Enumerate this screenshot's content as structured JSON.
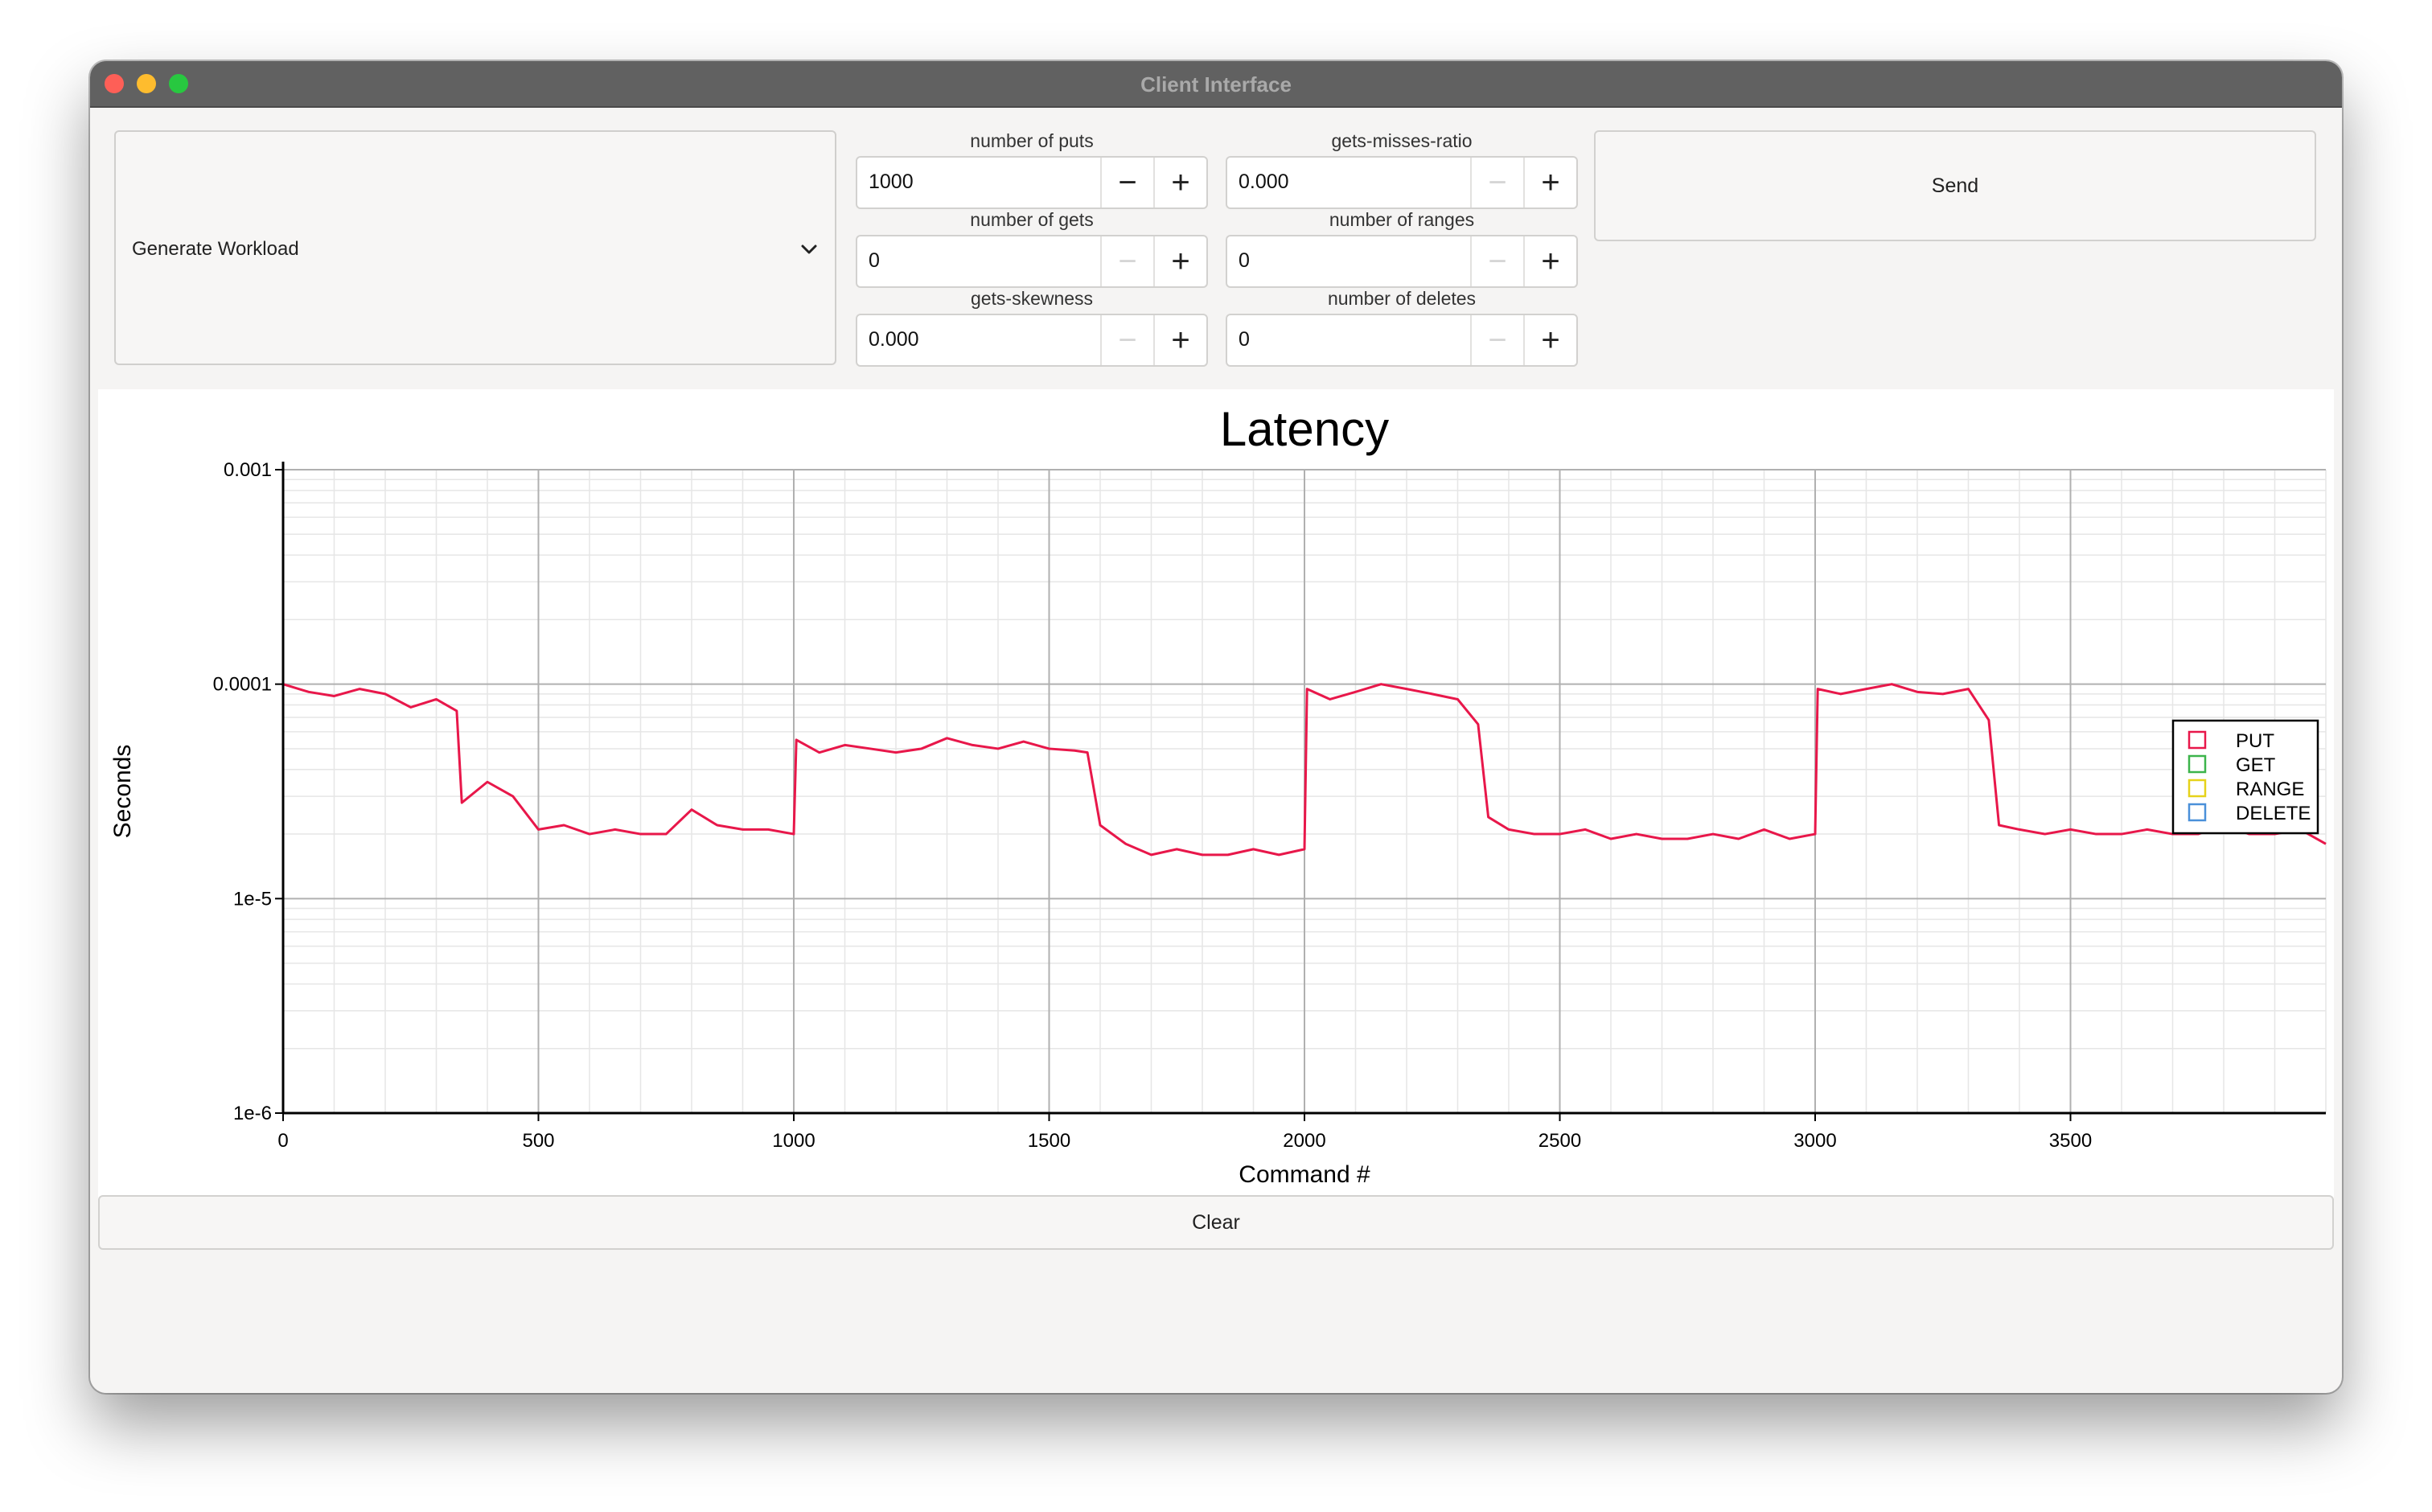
{
  "window": {
    "title": "Client Interface"
  },
  "workload": {
    "selected": "Generate Workload"
  },
  "fields": [
    {
      "label": "number of puts",
      "value": "1000"
    },
    {
      "label": "gets-misses-ratio",
      "value": "0.000"
    },
    {
      "label": "number of gets",
      "value": "0"
    },
    {
      "label": "number of ranges",
      "value": "0"
    },
    {
      "label": "gets-skewness",
      "value": "0.000"
    },
    {
      "label": "number of deletes",
      "value": "0"
    }
  ],
  "buttons": {
    "send": "Send",
    "clear": "Clear",
    "minus": "−",
    "plus": "+"
  },
  "chart_data": {
    "type": "line",
    "title": "Latency",
    "xlabel": "Command #",
    "ylabel": "Seconds",
    "y_scale": "log",
    "xlim": [
      0,
      4000
    ],
    "ylim": [
      1e-06,
      0.001
    ],
    "x_ticks": [
      "0",
      "500",
      "1000",
      "1500",
      "2000",
      "2500",
      "3000",
      "3500"
    ],
    "y_ticks": [
      "1e-6",
      "1e-5",
      "0.0001",
      "0.001"
    ],
    "grid": true,
    "legend_position": "right",
    "legend": [
      {
        "name": "PUT",
        "color": "#e8174a"
      },
      {
        "name": "GET",
        "color": "#3cb44b"
      },
      {
        "name": "RANGE",
        "color": "#e6d21a"
      },
      {
        "name": "DELETE",
        "color": "#4a90d9"
      }
    ],
    "series": [
      {
        "name": "PUT",
        "color": "#e8174a",
        "x": [
          0,
          50,
          100,
          150,
          200,
          250,
          300,
          340,
          350,
          400,
          450,
          500,
          550,
          600,
          650,
          700,
          750,
          800,
          850,
          900,
          950,
          1000,
          1005,
          1050,
          1100,
          1150,
          1200,
          1250,
          1300,
          1350,
          1400,
          1450,
          1500,
          1550,
          1575,
          1600,
          1650,
          1700,
          1750,
          1800,
          1850,
          1900,
          1950,
          2000,
          2005,
          2050,
          2100,
          2150,
          2200,
          2250,
          2300,
          2340,
          2360,
          2400,
          2450,
          2500,
          2550,
          2600,
          2650,
          2700,
          2750,
          2800,
          2850,
          2900,
          2950,
          3000,
          3005,
          3050,
          3100,
          3150,
          3200,
          3250,
          3300,
          3340,
          3360,
          3400,
          3450,
          3500,
          3550,
          3600,
          3650,
          3700,
          3750,
          3800,
          3850,
          3900,
          3950,
          4000
        ],
        "y": [
          0.0001,
          9.2e-05,
          8.8e-05,
          9.5e-05,
          9e-05,
          7.8e-05,
          8.5e-05,
          7.5e-05,
          2.8e-05,
          3.5e-05,
          3e-05,
          2.1e-05,
          2.2e-05,
          2e-05,
          2.1e-05,
          2e-05,
          2e-05,
          2.6e-05,
          2.2e-05,
          2.1e-05,
          2.1e-05,
          2e-05,
          5.5e-05,
          4.8e-05,
          5.2e-05,
          5e-05,
          4.8e-05,
          5e-05,
          5.6e-05,
          5.2e-05,
          5e-05,
          5.4e-05,
          5e-05,
          4.9e-05,
          4.8e-05,
          2.2e-05,
          1.8e-05,
          1.6e-05,
          1.7e-05,
          1.6e-05,
          1.6e-05,
          1.7e-05,
          1.6e-05,
          1.7e-05,
          9.5e-05,
          8.5e-05,
          9.2e-05,
          0.0001,
          9.5e-05,
          9e-05,
          8.5e-05,
          6.5e-05,
          2.4e-05,
          2.1e-05,
          2e-05,
          2e-05,
          2.1e-05,
          1.9e-05,
          2e-05,
          1.9e-05,
          1.9e-05,
          2e-05,
          1.9e-05,
          2.1e-05,
          1.9e-05,
          2e-05,
          9.5e-05,
          9e-05,
          9.5e-05,
          0.0001,
          9.2e-05,
          9e-05,
          9.5e-05,
          6.8e-05,
          2.2e-05,
          2.1e-05,
          2e-05,
          2.1e-05,
          2e-05,
          2e-05,
          2.1e-05,
          2e-05,
          2e-05,
          2.2e-05,
          2e-05,
          2e-05,
          2.1e-05,
          1.8e-05
        ]
      }
    ]
  }
}
